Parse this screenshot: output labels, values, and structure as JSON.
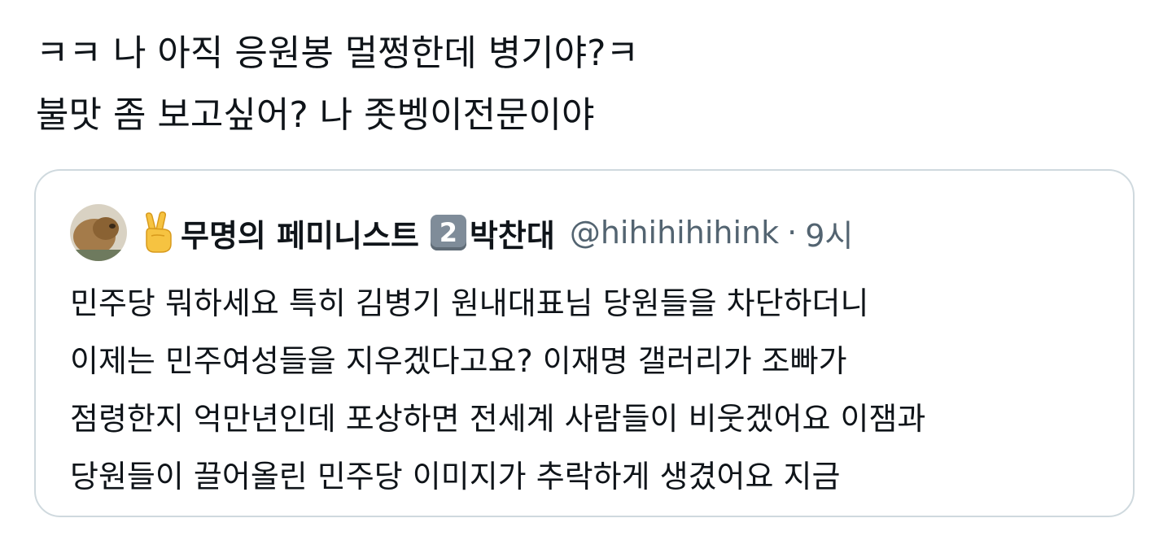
{
  "tweet": {
    "text_lines": [
      "ㅋㅋ 나 아직 응원봉 멀쩡한데 병기야?ㅋ",
      "불맛 좀 보고싶어? 나 좃벵이전문이야"
    ]
  },
  "quoted_tweet": {
    "display_name": "무명의 페미니스트",
    "name_badge_emoji": "victory-hand-icon",
    "keycap_number": "2",
    "name_suffix": "박찬대",
    "handle": "@hihihihihink",
    "separator": "·",
    "time": "9시",
    "text_lines": [
      "민주당 뭐하세요 특히 김병기 원내대표님 당원들을 차단하더니",
      "이제는 민주여성들을 지우겠다고요? 이재명 갤러리가 조빠가",
      "점령한지 억만년인데 포상하면 전세계 사람들이 비웃겠어요 이잼과",
      "당원들이 끌어올린 민주당 이미지가 추락하게 생겼어요 지금"
    ]
  },
  "colors": {
    "text_primary": "#0f1419",
    "text_secondary": "#536471",
    "card_border": "#cfd9de",
    "keycap_bg": "#7f8c99"
  }
}
